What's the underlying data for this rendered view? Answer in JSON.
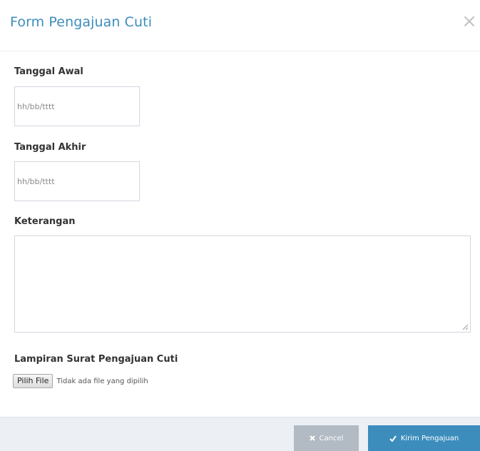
{
  "modal": {
    "title": "Form Pengajuan Cuti",
    "close_glyph": "×"
  },
  "form": {
    "start_date": {
      "label": "Tanggal Awal",
      "placeholder": "hh/bb/tttt"
    },
    "end_date": {
      "label": "Tanggal Akhir",
      "placeholder": "hh/bb/tttt"
    },
    "notes": {
      "label": "Keterangan",
      "value": ""
    },
    "attachment": {
      "label": "Lampiran Surat Pengajuan Cuti",
      "button_label": "Pilih File",
      "status": "Tidak ada file yang dipilih"
    }
  },
  "footer": {
    "cancel_label": "Cancel",
    "submit_label": "Kirim Pengajuan"
  },
  "icons": {
    "close": "close-icon",
    "cancel": "times-icon",
    "submit": "check-icon"
  },
  "colors": {
    "accent": "#3c8dbc",
    "cancel_bg": "#b2bac3",
    "footer_bg": "#ecf0f5"
  }
}
